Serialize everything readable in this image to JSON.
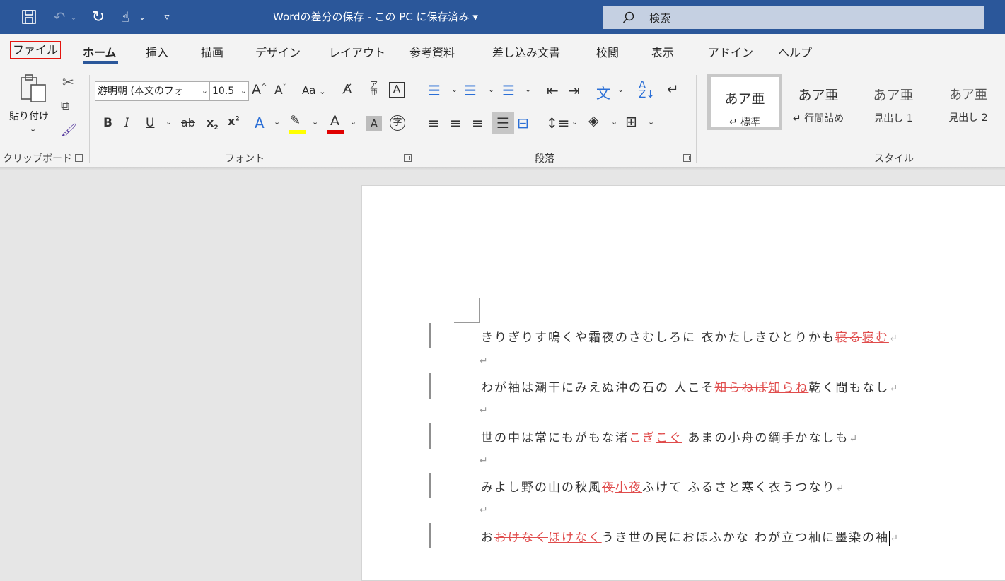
{
  "window": {
    "title": "Wordの差分の保存 - この PC に保存済み",
    "title_arrow": "▾",
    "search_placeholder": "検索"
  },
  "qat": {
    "save_icon": "save-icon",
    "undo_icon": "undo-icon",
    "redo_icon": "redo-icon",
    "touch_icon": "touch-mode-icon",
    "customize_icon": "customize-icon"
  },
  "tabs": [
    "ファイル",
    "ホーム",
    "挿入",
    "描画",
    "デザイン",
    "レイアウト",
    "参考資料",
    "差し込み文書",
    "校閲",
    "表示",
    "アドイン",
    "ヘルプ"
  ],
  "clipboard": {
    "paste_label": "貼り付け",
    "group_label": "クリップボード"
  },
  "font": {
    "font_name": "游明朝 (本文のフォ",
    "font_size": "10.5",
    "group_label": "フォント",
    "aa_label": "Aa"
  },
  "paragraph": {
    "group_label": "段落"
  },
  "styles": {
    "group_label": "スタイル",
    "items": [
      {
        "preview": "あア亜",
        "name": "↵ 標準"
      },
      {
        "preview": "あア亜",
        "name": "↵ 行間詰め"
      },
      {
        "preview": "あア亜",
        "name": "見出し 1"
      },
      {
        "preview": "あア亜",
        "name": "見出し 2"
      }
    ]
  },
  "document": {
    "lines": [
      {
        "pre": "きりぎりす鳴くや霜夜のさむしろに 衣かたしきひとりかも",
        "del": "寝る",
        "ins": "寝む",
        "post": ""
      },
      {
        "pre": "わが袖は潮干にみえぬ沖の石の 人こそ",
        "del": "知らねば",
        "ins": "知らね",
        "post": "乾く間もなし"
      },
      {
        "pre": "世の中は常にもがもな渚",
        "del": "こぎ",
        "ins": "こぐ",
        "post": " あまの小舟の綱手かなしも"
      },
      {
        "pre": "みよし野の山の秋風",
        "del": "夜",
        "ins": "小夜",
        "post": "ふけて ふるさと寒く衣うつなり"
      },
      {
        "pre": "お",
        "del": "おけなく",
        "ins": "ほけなく",
        "post": "うき世の民におほふかな わが立つ杣に墨染の袖"
      }
    ],
    "para_mark": "↵"
  }
}
